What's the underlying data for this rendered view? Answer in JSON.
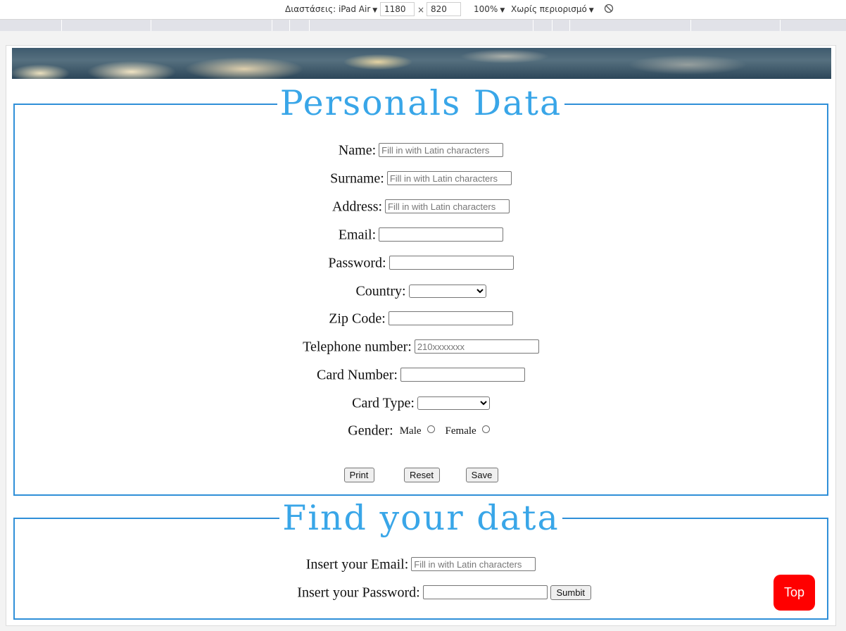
{
  "devtools": {
    "dimensions_label": "Διαστάσεις: iPad Air",
    "width_value": "1180",
    "height_value": "820",
    "zoom_label": "100%",
    "throttle_label": "Χωρίς περιορισμό"
  },
  "personal": {
    "legend": "Personals Data",
    "name_label": "Name:",
    "name_placeholder": "Fill in with Latin characters",
    "surname_label": "Surname:",
    "surname_placeholder": "Fill in with Latin characters",
    "address_label": "Address:",
    "address_placeholder": "Fill in with Latin characters",
    "email_label": "Email:",
    "password_label": "Password:",
    "country_label": "Country:",
    "zip_label": "Zip Code:",
    "phone_label": "Telephone number:",
    "phone_placeholder": "210xxxxxxx",
    "card_number_label": "Card Number:",
    "card_type_label": "Card Type:",
    "gender_label": "Gender:",
    "gender_male": "Male",
    "gender_female": "Female",
    "print_label": "Print",
    "reset_label": "Reset",
    "save_label": "Save"
  },
  "find": {
    "legend": "Find your data",
    "email_label": "Insert your Email:",
    "email_placeholder": "Fill in with Latin characters",
    "password_label": "Insert your Password:",
    "submit_label": "Sumbit"
  },
  "top_button_label": "Top",
  "colors": {
    "legend": "#39a6e8",
    "panel_border": "#2f8fd8",
    "top_button": "#ff0000"
  }
}
